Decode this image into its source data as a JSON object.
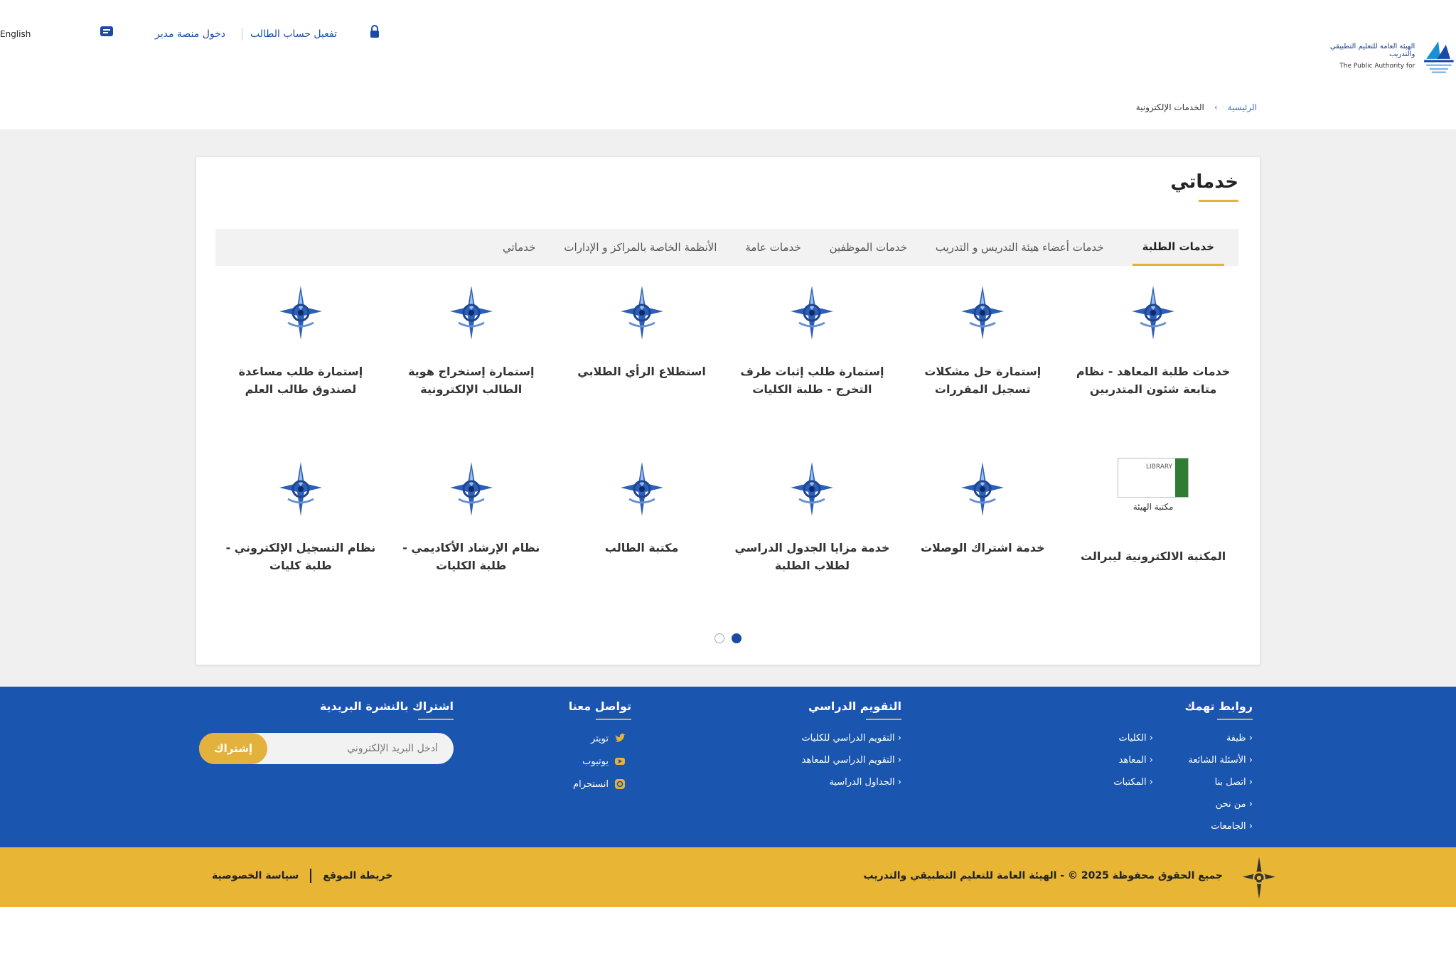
{
  "header": {
    "logo_name_ar": "الهيئة العامة للتعليم التطبيقي والتدريب",
    "logo_name_en": "The Public Authority for",
    "language_label": "English",
    "links": {
      "activate_student": "تفعيل حساب الطالب",
      "manager_portal": "دخول منصة مدير"
    }
  },
  "breadcrumb": {
    "home": "الرئيسية",
    "separator": "›",
    "current": "الخدمات الإلكترونية"
  },
  "main": {
    "title": "خدماتي",
    "tabs": [
      {
        "label": "خدمات الطلبة",
        "active": true
      },
      {
        "label": "خدمات أعضاء هيئة التدريس و التدريب",
        "active": false
      },
      {
        "label": "خدمات الموظفين",
        "active": false
      },
      {
        "label": "خدمات عامة",
        "active": false
      },
      {
        "label": "الأنظمة الخاصة بالمراكز و الإدارات",
        "active": false
      },
      {
        "label": "خدماتي",
        "active": false
      }
    ],
    "services": [
      {
        "label": "خدمات طلبة المعاهد - نظام متابعة شئون المتدربين",
        "icon": "paaet-emblem-icon"
      },
      {
        "label": "إستمارة حل مشكلات تسجيل المقررات",
        "icon": "paaet-emblem-icon"
      },
      {
        "label": "إستمارة طلب إثبات ظرف التخرج - طلبة الكليات",
        "icon": "paaet-emblem-icon"
      },
      {
        "label": "استطلاع الرأي الطلابي",
        "icon": "paaet-emblem-icon"
      },
      {
        "label": "إستمارة إستخراج هوية الطالب الإلكترونية",
        "icon": "paaet-emblem-icon"
      },
      {
        "label": "إستمارة طلب مساعدة لصندوق طالب العلم",
        "icon": "paaet-emblem-icon"
      },
      {
        "label": "المكتبة الالكترونية ليبرالت",
        "icon": "library-logo-icon",
        "logo_text": "LIBRARY",
        "logo_sub": "مكتبة الهيئة"
      },
      {
        "label": "خدمة اشتراك الوصلات",
        "icon": "paaet-emblem-icon"
      },
      {
        "label": "خدمة مزايا الجدول الدراسي لطلاب الطلبة",
        "icon": "paaet-emblem-icon"
      },
      {
        "label": "مكتبة الطالب",
        "icon": "paaet-emblem-icon"
      },
      {
        "label": "نظام الإرشاد الأكاديمي - طلبة الكليات",
        "icon": "paaet-emblem-icon"
      },
      {
        "label": "نظام التسجيل الإلكتروني - طلبة كليات",
        "icon": "paaet-emblem-icon"
      }
    ],
    "pagination": {
      "pages": 2,
      "active_index": 0
    }
  },
  "footer": {
    "links_col": {
      "title": "روابط تهمك",
      "items": [
        "ظيفة",
        "الأسئلة الشائعة",
        "اتصل بنا",
        "من نحن",
        "الجامعات",
        "الكليات",
        "المعاهد",
        "المكتبات"
      ]
    },
    "portal_col": {
      "title": "التقويم الدراسي",
      "items": [
        "التقويم الدراسي للكليات",
        "التقويم الدراسي للمعاهد"
      ],
      "extra": "الجداول الدراسية"
    },
    "contact_col": {
      "title": "تواصل معنا",
      "items": [
        {
          "label": "تويتر",
          "icon": "twitter-icon"
        },
        {
          "label": "يوتيوب",
          "icon": "youtube-icon"
        },
        {
          "label": "انستجرام",
          "icon": "instagram-icon"
        }
      ]
    },
    "subscribe_col": {
      "title": "اشتراك بالنشرة البريدية",
      "placeholder": "أدخل البريد الإلكتروني",
      "button": "إشتراك"
    }
  },
  "bottom_bar": {
    "copyright": "جميع الحقوق محفوظة 2025 © - الهيئة العامة للتعليم التطبيقي والتدريب",
    "privacy": "سياسة الخصوصية",
    "sitemap": "خريطة الموقع"
  },
  "colors": {
    "primary_blue": "#1a55b0",
    "accent_gold": "#e3b23c",
    "bottom_gold": "#e8b535",
    "page_gray": "#f0f0f1"
  }
}
